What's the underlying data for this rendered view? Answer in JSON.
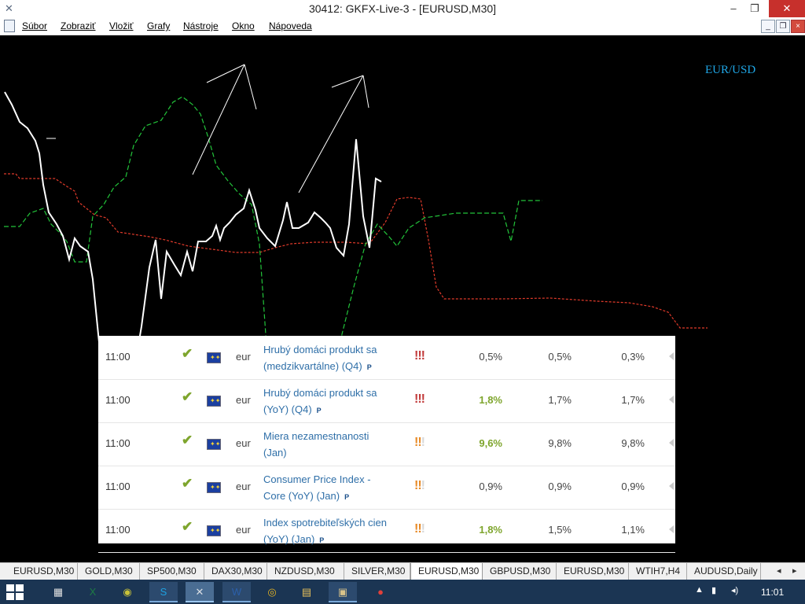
{
  "window": {
    "title": "30412: GKFX-Live-3 - [EURUSD,M30]",
    "app_icon": "x-logo-icon",
    "minimize": "–",
    "restore": "❐",
    "close": "✕"
  },
  "menu": {
    "items": [
      "Súbor",
      "Zobraziť",
      "Vložiť",
      "Grafy",
      "Nástroje",
      "Okno",
      "Nápoveda"
    ],
    "mdi_minimize": "_",
    "mdi_restore": "❐",
    "mdi_close": "×"
  },
  "chart": {
    "symbol_label": "EUR/USD",
    "colors": {
      "price": "#ffffff",
      "ichimoku_green": "#22c43a",
      "ichimoku_red": "#e03a2a",
      "background": "#000000"
    }
  },
  "calendar": {
    "rows": [
      {
        "time": "11:00",
        "currency": "eur",
        "event_line1": "Hrubý domáci produkt sa",
        "event_line2": "(medzikvartálne) (Q4)",
        "p_mark": "P",
        "importance": {
          "on": "!!!",
          "off": "",
          "color": "red"
        },
        "actual": "0,5%",
        "actual_highlight": false,
        "forecast": "0,5%",
        "previous": "0,3%"
      },
      {
        "time": "11:00",
        "currency": "eur",
        "event_line1": "Hrubý domáci produkt sa",
        "event_line2": "(YoY) (Q4)",
        "p_mark": "P",
        "importance": {
          "on": "!!!",
          "off": "",
          "color": "red"
        },
        "actual": "1,8%",
        "actual_highlight": true,
        "forecast": "1,7%",
        "previous": "1,7%"
      },
      {
        "time": "11:00",
        "currency": "eur",
        "event_line1": "Miera nezamestnanosti",
        "event_line2": "(Jan)",
        "p_mark": "",
        "importance": {
          "on": "!!",
          "off": "!",
          "color": "orange"
        },
        "actual": "9,6%",
        "actual_highlight": true,
        "forecast": "9,8%",
        "previous": "9,8%"
      },
      {
        "time": "11:00",
        "currency": "eur",
        "event_line1": "Consumer Price Index -",
        "event_line2": "Core (YoY) (Jan)",
        "p_mark": "P",
        "importance": {
          "on": "!!",
          "off": "!",
          "color": "orange"
        },
        "actual": "0,9%",
        "actual_highlight": false,
        "forecast": "0,9%",
        "previous": "0,9%"
      },
      {
        "time": "11:00",
        "currency": "eur",
        "event_line1": "Index spotrebiteľských cien",
        "event_line2": "(YoY) (Jan)",
        "p_mark": "P",
        "importance": {
          "on": "!!",
          "off": "!",
          "color": "orange"
        },
        "actual": "1,8%",
        "actual_highlight": true,
        "forecast": "1,5%",
        "previous": "1,1%"
      }
    ]
  },
  "tabs": {
    "items": [
      "EURUSD,M30",
      "GOLD,M30",
      "SP500,M30",
      "DAX30,M30",
      "NZDUSD,M30",
      "SILVER,M30",
      "EURUSD,M30",
      "GBPUSD,M30",
      "EURUSD,M30",
      "WTIH7,H4",
      "AUDUSD,Daily"
    ],
    "active_index": 6,
    "nav_left": "◂",
    "nav_right": "▸"
  },
  "taskbar": {
    "apps": [
      {
        "name": "app-tiles-icon",
        "glyph": "▦",
        "color": "#e0e0e0",
        "state": "none"
      },
      {
        "name": "excel-icon",
        "glyph": "X",
        "color": "#1e7b45",
        "state": "none"
      },
      {
        "name": "globe-app-icon",
        "glyph": "◉",
        "color": "#c8c23a",
        "state": "none"
      },
      {
        "name": "skype-icon",
        "glyph": "S",
        "color": "#1ea0e0",
        "state": "open"
      },
      {
        "name": "metatrader-icon",
        "glyph": "✕",
        "color": "#d8dde4",
        "state": "active"
      },
      {
        "name": "word-icon",
        "glyph": "W",
        "color": "#2b5faa",
        "state": "open"
      },
      {
        "name": "chrome-icon",
        "glyph": "◎",
        "color": "#e6b422",
        "state": "none"
      },
      {
        "name": "file-explorer-icon",
        "glyph": "▤",
        "color": "#e8c15a",
        "state": "none"
      },
      {
        "name": "image-app-icon",
        "glyph": "▣",
        "color": "#d9c38a",
        "state": "open"
      },
      {
        "name": "dots-app-icon",
        "glyph": "●",
        "color": "#e0403a",
        "state": "none"
      }
    ],
    "tray": {
      "chevron": "▲",
      "network": "▮",
      "volume": "◂)"
    },
    "clock": "11:01"
  }
}
